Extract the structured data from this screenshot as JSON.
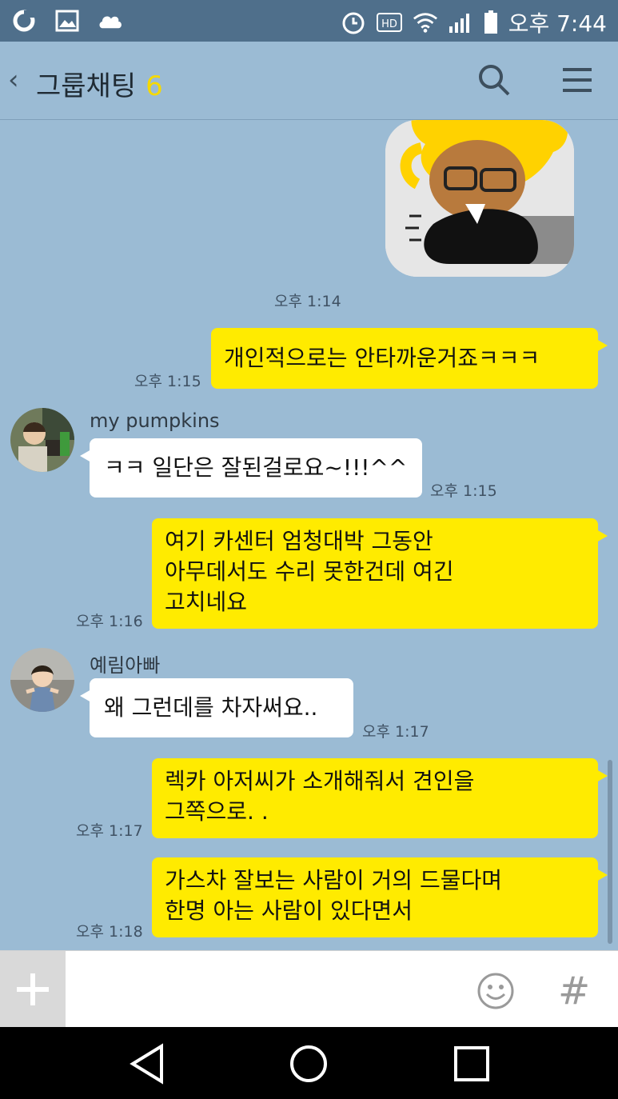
{
  "statusbar": {
    "left_icons": [
      "o-app-icon",
      "gallery-icon",
      "cloud-icon"
    ],
    "right_icons": [
      "alarm-icon",
      "hd-icon",
      "wifi-icon",
      "signal-icon",
      "battery-icon"
    ],
    "hd_text": "HD",
    "time": "오후 7:44"
  },
  "header": {
    "title": "그룹채팅",
    "member_count": "6"
  },
  "messages": [
    {
      "type": "sticker",
      "time": "오후 1:14"
    },
    {
      "type": "mine",
      "text": "개인적으로는 안타까운거죠ㅋㅋㅋ",
      "time": "오후 1:15"
    },
    {
      "type": "other",
      "sender": "my pumpkins",
      "text": "ㅋㅋ 일단은 잘된걸로요~!!!^^",
      "time": "오후 1:15"
    },
    {
      "type": "mine",
      "lines": [
        "여기 카센터 엄청대박 그동안",
        "아무데서도 수리 못한건데 여긴",
        "고치네요"
      ],
      "time": "오후 1:16"
    },
    {
      "type": "other",
      "sender": "예림아빠",
      "text": "왜 그런데를 차자써요..",
      "time": "오후 1:17"
    },
    {
      "type": "mine",
      "lines": [
        "렉카 아저씨가 소개해줘서 견인을",
        "그쪽으로. ."
      ],
      "time": "오후 1:17"
    },
    {
      "type": "mine",
      "lines": [
        "가스차 잘보는 사람이 거의 드물다며",
        "한명 아는 사람이 있다면서"
      ],
      "time": "오후 1:18"
    }
  ],
  "colors": {
    "background": "#9bbbd4",
    "my_bubble": "#ffeb00",
    "other_bubble": "#ffffff",
    "count": "#f6d900"
  }
}
